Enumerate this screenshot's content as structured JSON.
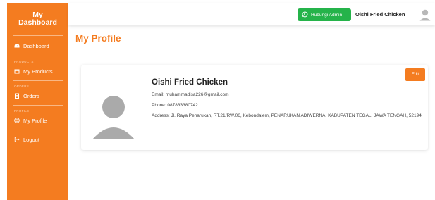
{
  "sidebar": {
    "brand_line1": "My",
    "brand_line2": "Dashboard",
    "dashboard_label": "Dashboard",
    "products_section": "PRODUCTS",
    "products_label": "My Products",
    "orders_section": "ORDERS",
    "orders_label": "Orders",
    "profile_section": "PROFILE",
    "profile_label": "My Profile",
    "logout_label": "Logout"
  },
  "topbar": {
    "whatsapp_label": "Hubungi Admin",
    "store_name": "Oishi Fried Chicken"
  },
  "page": {
    "title": "My Profile"
  },
  "profile": {
    "edit_label": "Edit",
    "name": "Oishi Fried Chicken",
    "email": "Email: muhammadisa226@gmail.com",
    "phone": "Phone: 087833380742",
    "address": "Address: Jl. Raya Penarukan, RT.21/RW.06, Kebondalem, PENARUKAN ADIWERNA, KABUPATEN TEGAL, JAWA TENGAH, 52194"
  },
  "colors": {
    "brand": "#f47c20",
    "whatsapp": "#25b34a"
  },
  "icons": [
    "dashboard-icon",
    "box-icon",
    "clipboard-icon",
    "user-icon",
    "logout-icon",
    "whatsapp-icon",
    "avatar-icon"
  ]
}
